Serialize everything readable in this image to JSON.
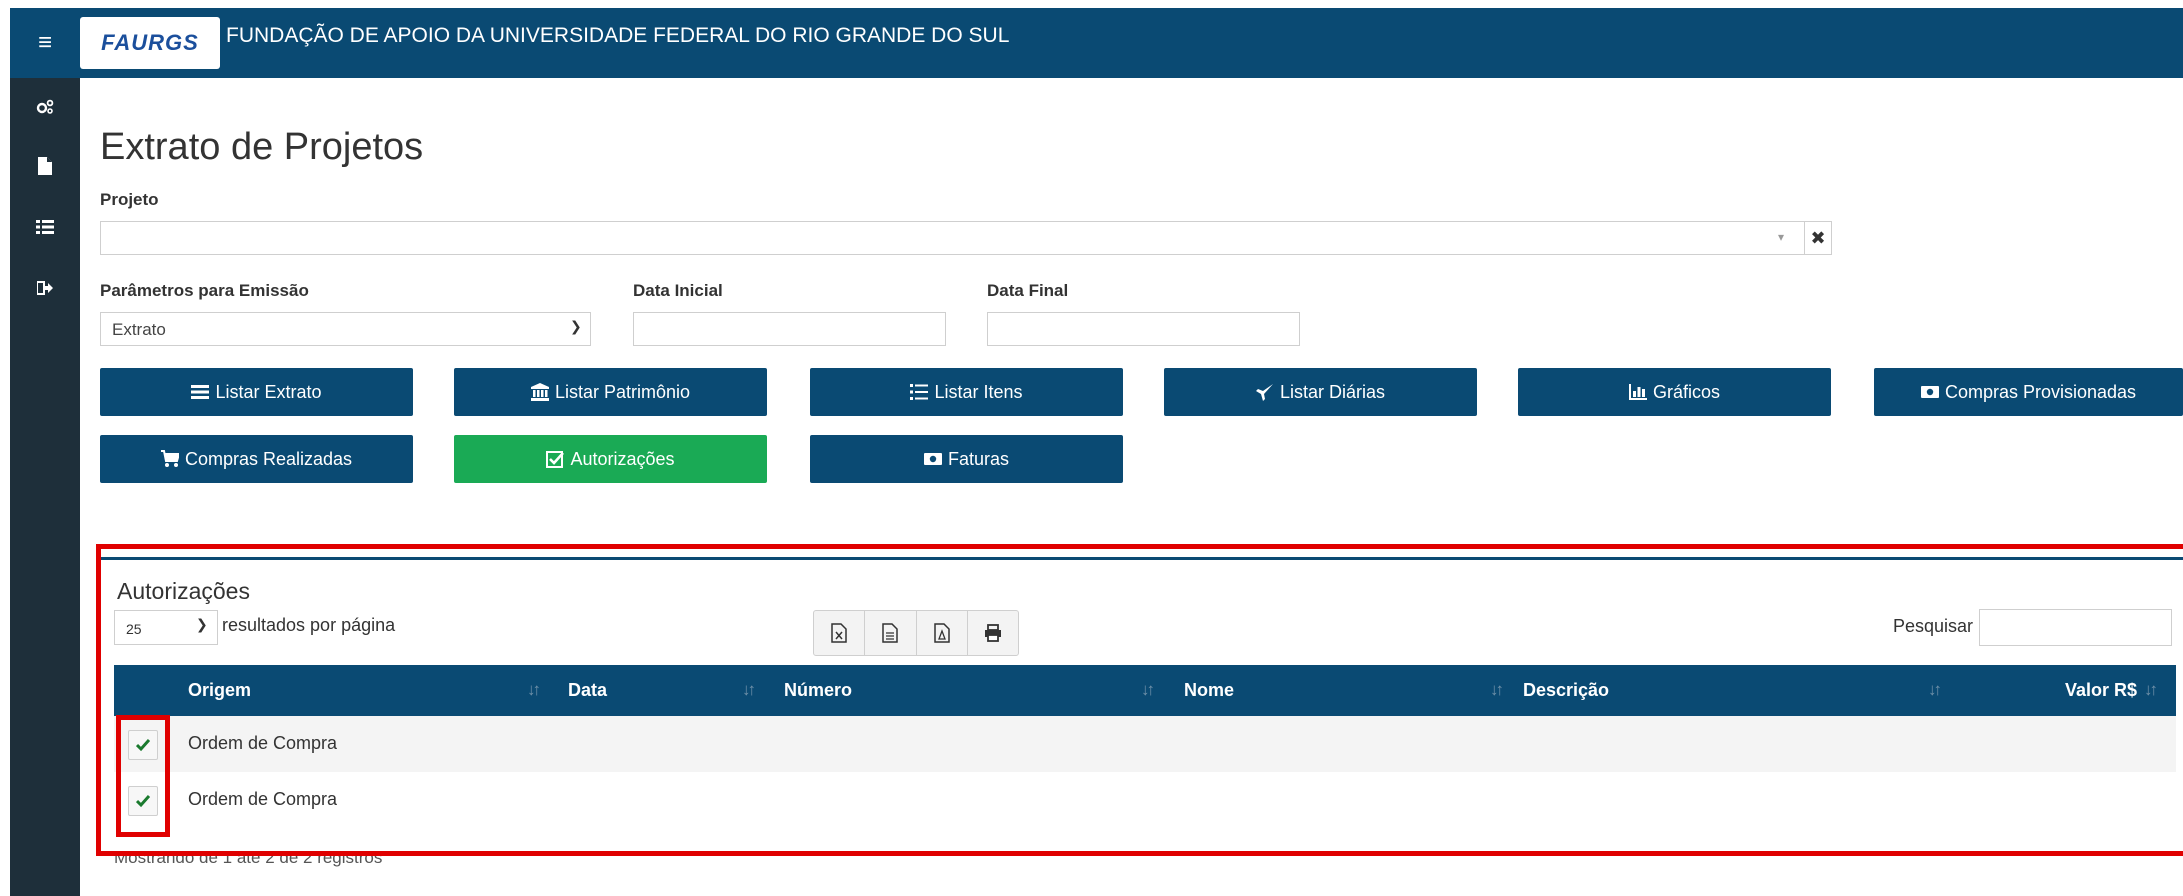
{
  "header": {
    "menu_icon": "hamburger-icon",
    "logo_text": "FAURGS",
    "title": "FUNDAÇÃO DE APOIO DA UNIVERSIDADE FEDERAL DO RIO GRANDE DO SUL",
    "color": "#0a4a73"
  },
  "sidebar": {
    "items": [
      {
        "icon": "gears-icon"
      },
      {
        "icon": "file-icon"
      },
      {
        "icon": "list-icon"
      },
      {
        "icon": "sign-out-icon"
      }
    ]
  },
  "page": {
    "title": "Extrato de Projetos"
  },
  "form": {
    "projeto_label": "Projeto",
    "projeto_value": "",
    "parametros_label": "Parâmetros para Emissão",
    "parametros_value": "Extrato",
    "data_inicial_label": "Data Inicial",
    "data_inicial_value": "",
    "data_final_label": "Data Final",
    "data_final_value": ""
  },
  "buttons": {
    "listar_extrato": "Listar Extrato",
    "listar_patrimonio": "Listar Patrimônio",
    "listar_itens": "Listar Itens",
    "listar_diarias": "Listar Diárias",
    "graficos": "Gráficos",
    "compras_provisionadas": "Compras Provisionadas",
    "compras_realizadas": "Compras Realizadas",
    "autorizacoes": "Autorizações",
    "faturas": "Faturas",
    "active": "autorizacoes",
    "active_color": "#1aaa55"
  },
  "panel": {
    "title": "Autorizações",
    "page_length": "25",
    "page_length_label": "resultados por página",
    "search_label": "Pesquisar",
    "search_value": "",
    "export_icons": [
      "excel-icon",
      "csv-icon",
      "pdf-icon",
      "print-icon"
    ]
  },
  "table": {
    "columns": [
      "Origem",
      "Data",
      "Número",
      "Nome",
      "Descrição",
      "Valor R$"
    ],
    "rows": [
      {
        "origem": "Ordem de Compra",
        "data": "",
        "numero": "",
        "nome": "",
        "descricao": "",
        "valor": ""
      },
      {
        "origem": "Ordem de Compra",
        "data": "",
        "numero": "",
        "nome": "",
        "descricao": "",
        "valor": ""
      }
    ],
    "info": "Mostrando de 1 até 2 de 2 registros"
  }
}
